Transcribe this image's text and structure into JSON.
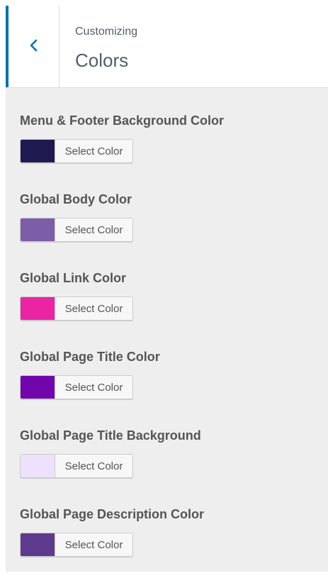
{
  "header": {
    "subtitle": "Customizing",
    "title": "Colors"
  },
  "icons": {
    "back": "chevron-left-icon"
  },
  "colors": {
    "accent": "#0073aa"
  },
  "controls": [
    {
      "label": "Menu & Footer Background Color",
      "button_label": "Select Color",
      "color": "#1e1a4f"
    },
    {
      "label": "Global Body Color",
      "button_label": "Select Color",
      "color": "#7b5ea7"
    },
    {
      "label": "Global Link Color",
      "button_label": "Select Color",
      "color": "#e925a3"
    },
    {
      "label": "Global Page Title Color",
      "button_label": "Select Color",
      "color": "#7006ab"
    },
    {
      "label": "Global Page Title Background",
      "button_label": "Select Color",
      "color": "#ede1fb"
    },
    {
      "label": "Global Page Description Color",
      "button_label": "Select Color",
      "color": "#5e3a8c"
    }
  ]
}
